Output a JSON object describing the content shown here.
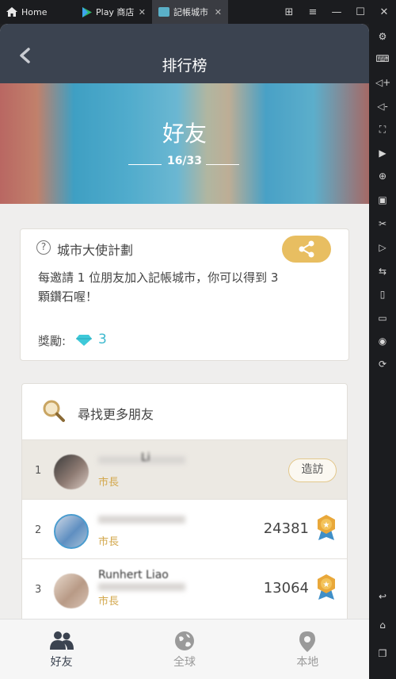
{
  "emulator": {
    "tabs": [
      {
        "label": "Home"
      },
      {
        "label": "Play 商店"
      },
      {
        "label": "記帳城市"
      }
    ]
  },
  "header": {
    "title": "排行榜"
  },
  "banner": {
    "title": "好友",
    "progress": "16/33"
  },
  "ambassador": {
    "title": "城市大使計劃",
    "description": "每邀請 1 位朋友加入記帳城市，你可以得到 3 顆鑽石喔！",
    "reward_label": "獎勵:",
    "reward_value": "3"
  },
  "friends": {
    "search_label": "尋找更多朋友",
    "rows": [
      {
        "rank": "1",
        "name": "Li",
        "role": "市長",
        "action": "造訪"
      },
      {
        "rank": "2",
        "name": "",
        "role": "市長",
        "score": "24381"
      },
      {
        "rank": "3",
        "name": "Runhert Liao",
        "role": "市長",
        "score": "13064"
      }
    ]
  },
  "bottom_nav": [
    {
      "label": "好友",
      "active": true
    },
    {
      "label": "全球",
      "active": false
    },
    {
      "label": "本地",
      "active": false
    }
  ],
  "colors": {
    "header": "#3b4350",
    "accent_gold": "#e8be61",
    "gem": "#3db9cf",
    "nav_active": "#3b4350",
    "nav_inactive": "#9a9a9a"
  }
}
